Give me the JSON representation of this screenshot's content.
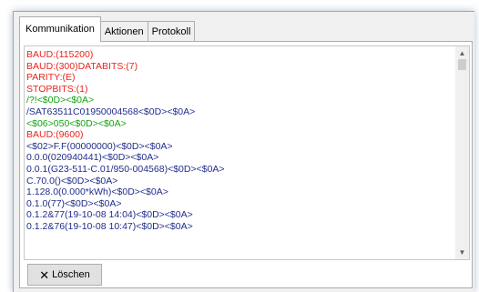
{
  "colors": {
    "red": "#e8241c",
    "green": "#12a212",
    "blue": "#1f2d8c"
  },
  "tabs": [
    {
      "label": "Kommunikation"
    },
    {
      "label": "Aktionen"
    },
    {
      "label": "Protokoll"
    }
  ],
  "log": {
    "lines": [
      {
        "text": "BAUD:(115200)",
        "color": "red"
      },
      {
        "text": "BAUD:(300)DATABITS:(7)",
        "color": "red"
      },
      {
        "text": "PARITY:(E)",
        "color": "red"
      },
      {
        "text": "STOPBITS:(1)",
        "color": "red"
      },
      {
        "text": "/?!<$0D><$0A>",
        "color": "green"
      },
      {
        "text": "/SAT63511C01950004568<$0D><$0A>",
        "color": "blue"
      },
      {
        "text": "<$06>050<$0D><$0A>",
        "color": "green"
      },
      {
        "text": "BAUD:(9600)",
        "color": "red"
      },
      {
        "text": "<$02>F.F(00000000)<$0D><$0A>",
        "color": "blue"
      },
      {
        "text": "0.0.0(020940441)<$0D><$0A>",
        "color": "blue"
      },
      {
        "text": "0.0.1(G23-511-C.01/950-004568)<$0D><$0A>",
        "color": "blue"
      },
      {
        "text": "C.70.0()<$0D><$0A>",
        "color": "blue"
      },
      {
        "text": "1.128.0(0.000*kWh)<$0D><$0A>",
        "color": "blue"
      },
      {
        "text": "0.1.0(77)<$0D><$0A>",
        "color": "blue"
      },
      {
        "text": "0.1.2&77(19-10-08 14:04)<$0D><$0A>",
        "color": "blue"
      },
      {
        "text": "0.1.2&76(19-10-08 10:47)<$0D><$0A>",
        "color": "blue"
      }
    ]
  },
  "scrollbar": {
    "up_icon": "▲",
    "down_icon": "▼"
  },
  "clear_button": {
    "icon": "✕",
    "label": "Löschen"
  }
}
